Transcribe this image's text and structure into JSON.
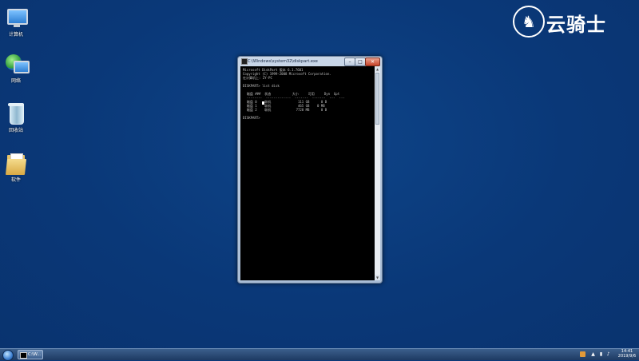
{
  "desktop_icons": [
    {
      "name": "computer",
      "label": "计算机"
    },
    {
      "name": "network",
      "label": "网络"
    },
    {
      "name": "recycle-bin",
      "label": "回收站"
    },
    {
      "name": "software",
      "label": "软件"
    }
  ],
  "logo": {
    "symbol": "♞",
    "text": "云骑士"
  },
  "window": {
    "title": "C:\\Windows\\system32\\diskpart.exe",
    "controls": {
      "minimize": "–",
      "maximize": "□",
      "close": "✕"
    },
    "console_text": "Microsoft DiskPart 版本 6.1.7601\nCopyright (C) 1999-2008 Microsoft Corporation.\n在计算机上: ZY-PC\n\nDISKPART> list disk\n\n  磁盘 ###  状态           大小     可用     Dyn  Gpt\n  --------  -------------  -------  -------  ---  ---\n  磁盘 0    联机              111 GB      0 B\n  磁盘 1    联机              465 GB    0 MB\n  磁盘 2    联机             7728 MB      0 B\n\nDISKPART>"
  },
  "taskbar": {
    "task_label": "C:\\W...",
    "tray": {
      "chevron": "▲",
      "network": "▮",
      "volume": "♪"
    },
    "time": "14:41",
    "date": "2019/9/6"
  }
}
